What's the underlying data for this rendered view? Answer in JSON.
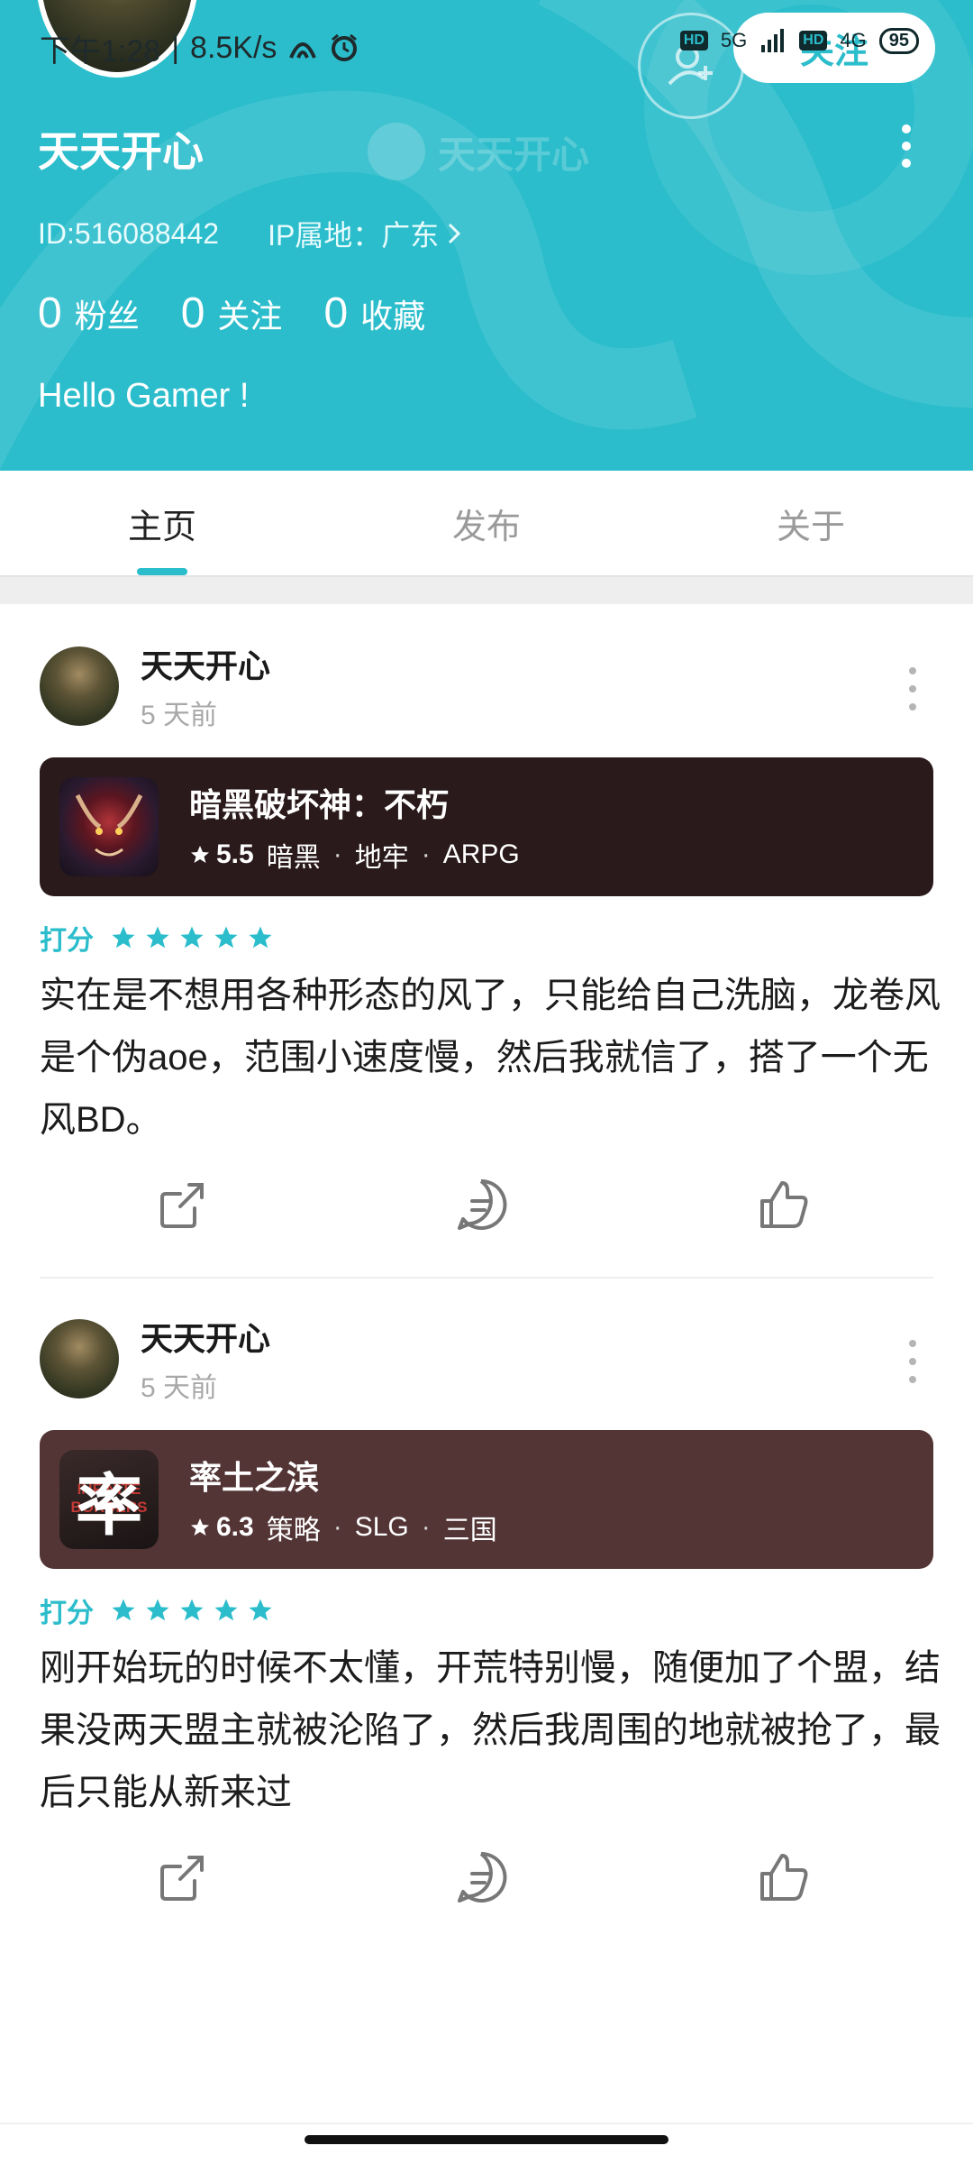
{
  "status_bar": {
    "time": "下午1:28",
    "speed": "8.5K/s",
    "net1": "5G",
    "net2": "4G",
    "battery": "95"
  },
  "profile": {
    "follow_label": "关注",
    "name": "天天开心",
    "id_text": "ID:516088442",
    "ip_text": "IP属地：广东",
    "stats": [
      {
        "num": "0",
        "label": "粉丝"
      },
      {
        "num": "0",
        "label": "关注"
      },
      {
        "num": "0",
        "label": "收藏"
      }
    ],
    "bio": "Hello Gamer !"
  },
  "tabs": [
    "主页",
    "发布",
    "关于"
  ],
  "posts": [
    {
      "user": "天天开心",
      "time": "5 天前",
      "game": {
        "name": "暗黑破坏神：不朽",
        "score": "5.5",
        "tags": [
          "暗黑",
          "地牢",
          "ARPG"
        ],
        "card_color": "#2a1a1c"
      },
      "rating_label": "打分",
      "stars": 5,
      "text": "实在是不想用各种形态的风了，只能给自己洗脑，龙卷风是个伪aoe，范围小速度慢，然后我就信了，搭了一个无风BD。"
    },
    {
      "user": "天天开心",
      "time": "5 天前",
      "game": {
        "name": "率土之滨",
        "score": "6.3",
        "tags": [
          "策略",
          "SLG",
          "三国"
        ],
        "card_color": "#533536",
        "icon_char": "率",
        "icon_watermark": "INFINITE BORDERS"
      },
      "rating_label": "打分",
      "stars": 5,
      "text": "刚开始玩的时候不太懂，开荒特别慢，随便加了个盟，结果没两天盟主就被沦陷了，然后我周围的地就被抢了，最后只能从新来过"
    }
  ],
  "colors": {
    "accent": "#2bbdcb",
    "header_bg": "#2bbdcb"
  }
}
